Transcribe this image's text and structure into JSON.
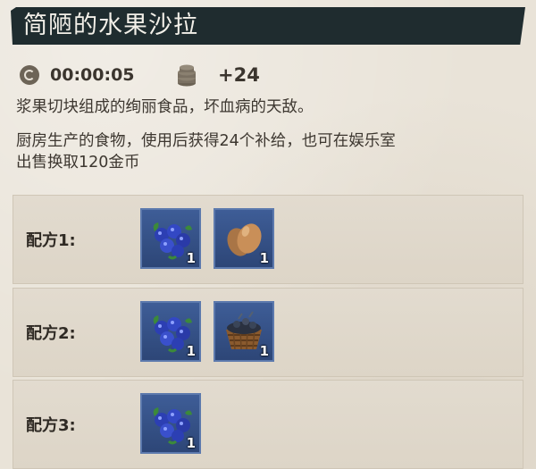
{
  "item": {
    "title": "简陋的水果沙拉",
    "time": "00:00:05",
    "coins": "+24",
    "description": "浆果切块组成的绚丽食品，坏血病的天敌。",
    "usage_line1": "厨房生产的食物，使用后获得24个补给，也可在娱乐室",
    "usage_line2": "出售换取120金币"
  },
  "recipes": [
    {
      "label": "配方1:",
      "ingredients": [
        {
          "icon": "blueberry-icon",
          "qty": "1"
        },
        {
          "icon": "egg-icon",
          "qty": "1"
        }
      ]
    },
    {
      "label": "配方2:",
      "ingredients": [
        {
          "icon": "blueberry-icon",
          "qty": "1"
        },
        {
          "icon": "basket-icon",
          "qty": "1"
        }
      ]
    },
    {
      "label": "配方3:",
      "ingredients": [
        {
          "icon": "blueberry-icon",
          "qty": "1"
        }
      ]
    }
  ],
  "colors": {
    "title_bar": "#1f2c2f",
    "slot_bg": "#3e5d97",
    "parchment": "#e9e3d8"
  }
}
